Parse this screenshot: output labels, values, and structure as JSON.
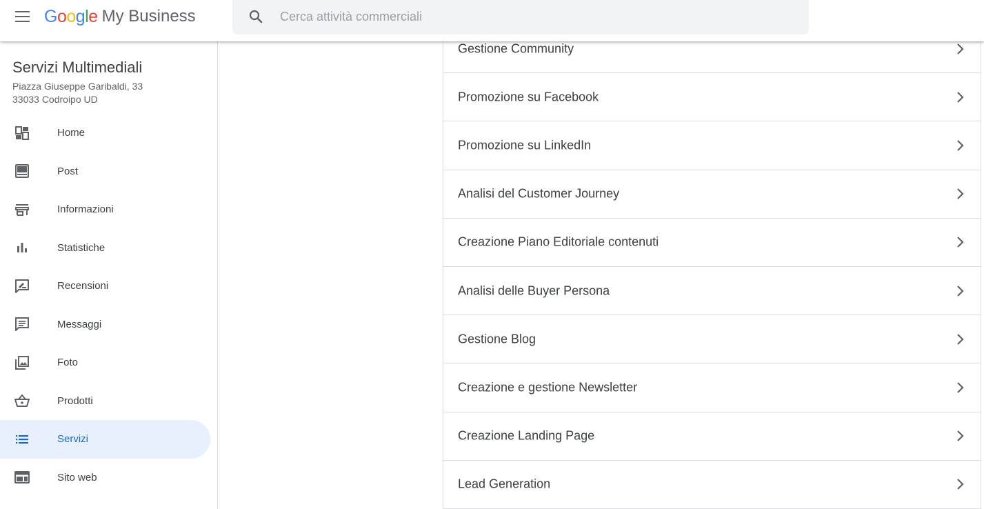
{
  "header": {
    "logo_letters": [
      {
        "ch": "G",
        "color": "#4285F4"
      },
      {
        "ch": "o",
        "color": "#EA4335"
      },
      {
        "ch": "o",
        "color": "#FBBC05"
      },
      {
        "ch": "g",
        "color": "#4285F4"
      },
      {
        "ch": "l",
        "color": "#34A853"
      },
      {
        "ch": "e",
        "color": "#EA4335"
      }
    ],
    "logo_product": "My Business",
    "search_placeholder": "Cerca attività commerciali"
  },
  "business": {
    "name": "Servizi Multimediali",
    "address_line1": "Piazza Giuseppe Garibaldi, 33",
    "address_line2": "33033 Codroipo UD"
  },
  "sidebar": {
    "items": [
      {
        "label": "Home",
        "icon": "dashboard-icon",
        "active": false
      },
      {
        "label": "Post",
        "icon": "post-icon",
        "active": false
      },
      {
        "label": "Informazioni",
        "icon": "store-icon",
        "active": false
      },
      {
        "label": "Statistiche",
        "icon": "bar-chart-icon",
        "active": false
      },
      {
        "label": "Recensioni",
        "icon": "rate-review-icon",
        "active": false
      },
      {
        "label": "Messaggi",
        "icon": "message-icon",
        "active": false
      },
      {
        "label": "Foto",
        "icon": "photo-library-icon",
        "active": false
      },
      {
        "label": "Prodotti",
        "icon": "basket-icon",
        "active": true
      },
      {
        "label": "Servizi",
        "icon": "list-icon",
        "active": true
      },
      {
        "label": "Sito web",
        "icon": "web-icon",
        "active": false
      }
    ]
  },
  "services": {
    "items": [
      "Gestione Community",
      "Promozione su Facebook",
      "Promozione su LinkedIn",
      "Analisi del Customer Journey",
      "Creazione Piano Editoriale contenuti",
      "Analisi delle Buyer Persona",
      "Gestione Blog",
      "Creazione e gestione Newsletter",
      "Creazione Landing Page",
      "Lead Generation"
    ]
  },
  "colors": {
    "accent": "#1967d2",
    "active_bg": "#e8f0fe",
    "icon_gray": "#5f6368",
    "divider": "#dadce0"
  }
}
